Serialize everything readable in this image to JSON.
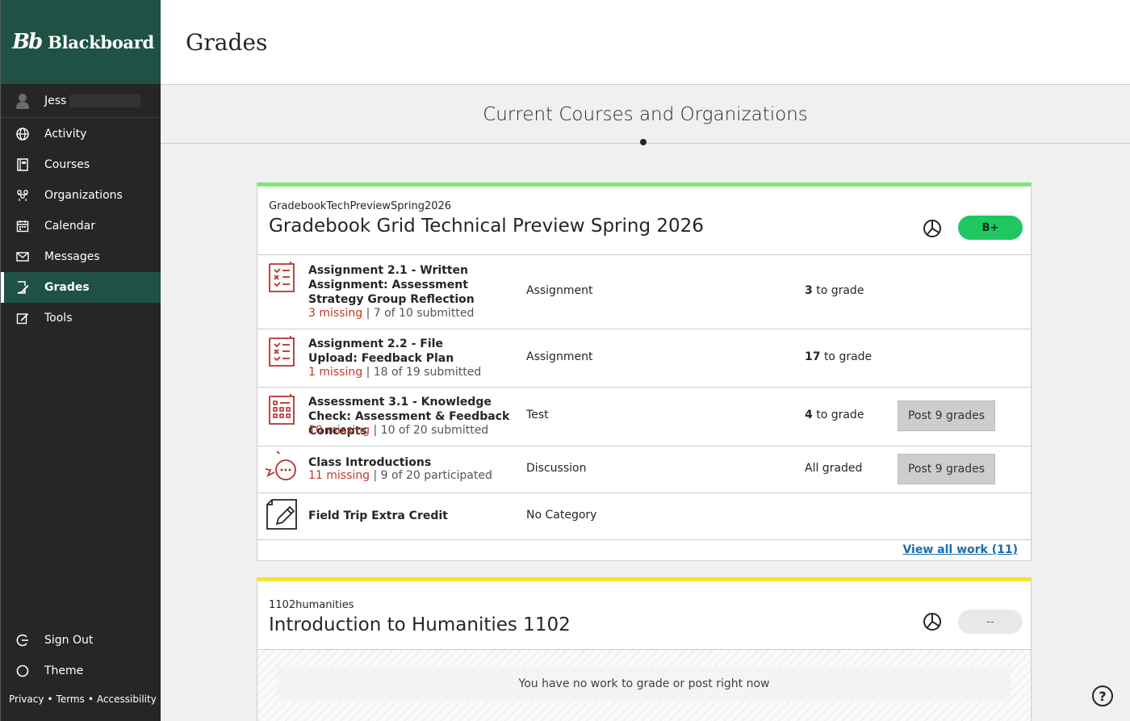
{
  "brand": {
    "mark": "Bb",
    "name": "Blackboard"
  },
  "user": {
    "name": "Jess"
  },
  "nav": {
    "items": [
      {
        "label": "Activity",
        "icon": "globe-icon"
      },
      {
        "label": "Courses",
        "icon": "book-icon"
      },
      {
        "label": "Organizations",
        "icon": "people-icon"
      },
      {
        "label": "Calendar",
        "icon": "calendar-icon"
      },
      {
        "label": "Messages",
        "icon": "envelope-icon"
      },
      {
        "label": "Grades",
        "icon": "grades-icon",
        "active": true
      },
      {
        "label": "Tools",
        "icon": "tools-icon"
      }
    ],
    "sign_out": "Sign Out",
    "theme": "Theme"
  },
  "footer": {
    "privacy": "Privacy",
    "terms": "Terms",
    "accessibility": "Accessibility",
    "separator": "•"
  },
  "page": {
    "title": "Grades",
    "section_title": "Current Courses and Organizations"
  },
  "courses": [
    {
      "id": "GradebookTechPreviewSpring2026",
      "title": "Gradebook Grid Technical Preview Spring 2026",
      "grade": "B+",
      "accent": "#7fe67a",
      "items": [
        {
          "title": "Assignment 2.1 - Written Assignment: Assessment Strategy Group Reflection",
          "missing": "3 missing",
          "sep": "|",
          "submitted": "7 of 10 submitted",
          "category": "Assignment",
          "to_grade_count": "3",
          "to_grade_label": "to grade",
          "icon": "assignment-icon"
        },
        {
          "title": "Assignment 2.2 - File Upload: Feedback Plan",
          "missing": "1 missing",
          "sep": "|",
          "submitted": "18 of 19 submitted",
          "category": "Assignment",
          "to_grade_count": "17",
          "to_grade_label": "to grade",
          "icon": "assignment-icon"
        },
        {
          "title": "Assessment 3.1 - Knowledge Check: Assessment & Feedback Concepts",
          "missing": "10 missing",
          "sep": "|",
          "submitted": "10 of 20 submitted",
          "category": "Test",
          "to_grade_count": "4",
          "to_grade_label": "to grade",
          "post_label": "Post 9 grades",
          "icon": "test-icon"
        },
        {
          "title": "Class Introductions",
          "missing": "11 missing",
          "sep": "|",
          "submitted": "9 of 20 participated",
          "category": "Discussion",
          "status": "All graded",
          "post_label": "Post 9 grades",
          "icon": "discussion-icon"
        },
        {
          "title": "Field Trip Extra Credit",
          "category": "No Category",
          "icon": "document-pencil-icon"
        }
      ],
      "view_all": "View all work (11)"
    },
    {
      "id": "1102humanities",
      "title": "Introduction to Humanities 1102",
      "grade": "--",
      "accent": "#f8e12f",
      "empty_message": "You have no work to grade or post right now"
    }
  ],
  "help": {
    "label": "?"
  }
}
